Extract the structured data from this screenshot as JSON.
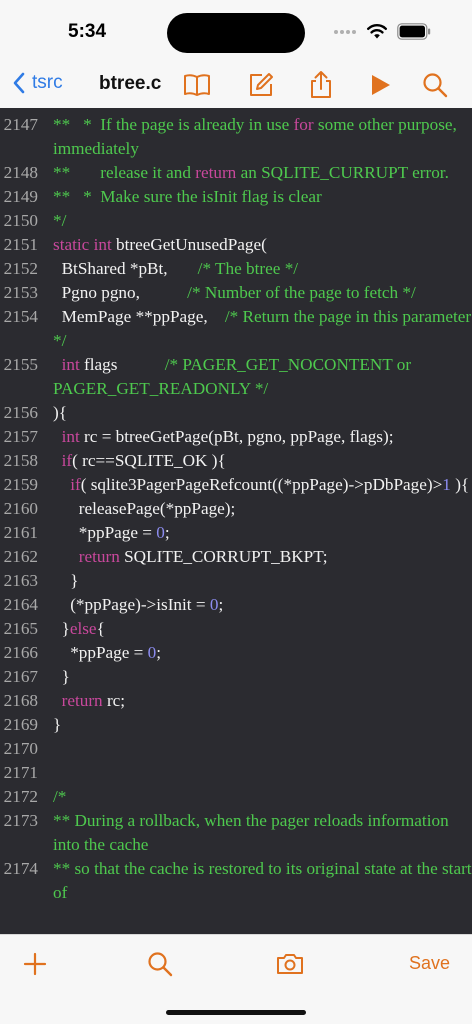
{
  "status_bar": {
    "time": "5:34"
  },
  "nav": {
    "back_label": "tsrc",
    "file_name": "btree.c"
  },
  "toolbar": {
    "save_label": "Save"
  },
  "colors": {
    "accent_orange": "#e0721f",
    "link_blue": "#2f7be5",
    "comment_green": "#4ec94e",
    "keyword_pink": "#c8489c",
    "number_purple": "#8d8df0",
    "editor_bg": "#2b2b30"
  },
  "icons": [
    "chevron-left-icon",
    "book-icon",
    "edit-icon",
    "share-icon",
    "play-icon",
    "search-icon",
    "plus-icon",
    "camera-icon"
  ],
  "code_lines": [
    {
      "num": "2147",
      "segments": [
        {
          "t": "**   *  If the page is already in use ",
          "s": "c"
        },
        {
          "t": "for",
          "s": "k"
        },
        {
          "t": " some other purpose, immediately",
          "s": "c"
        }
      ]
    },
    {
      "num": "2148",
      "segments": [
        {
          "t": "**       release it and ",
          "s": "c"
        },
        {
          "t": "return",
          "s": "k"
        },
        {
          "t": " an SQLITE_CURRUPT error.",
          "s": "c"
        }
      ]
    },
    {
      "num": "2149",
      "segments": [
        {
          "t": "**   *  Make sure the isInit flag is clear",
          "s": "c"
        }
      ]
    },
    {
      "num": "2150",
      "segments": [
        {
          "t": "*/",
          "s": "c"
        }
      ]
    },
    {
      "num": "2151",
      "segments": [
        {
          "t": "static",
          "s": "k"
        },
        {
          "t": " ",
          "s": ""
        },
        {
          "t": "int",
          "s": "k"
        },
        {
          "t": " btreeGetUnusedPage(",
          "s": ""
        }
      ]
    },
    {
      "num": "2152",
      "segments": [
        {
          "t": "  BtShared *pBt,       ",
          "s": ""
        },
        {
          "t": "/* The btree */",
          "s": "c"
        }
      ]
    },
    {
      "num": "2153",
      "segments": [
        {
          "t": "  Pgno pgno,           ",
          "s": ""
        },
        {
          "t": "/* Number of the page to fetch */",
          "s": "c"
        }
      ]
    },
    {
      "num": "2154",
      "segments": [
        {
          "t": "  MemPage **ppPage,    ",
          "s": ""
        },
        {
          "t": "/* Return the page in this parameter */",
          "s": "c"
        }
      ]
    },
    {
      "num": "2155",
      "segments": [
        {
          "t": "  ",
          "s": ""
        },
        {
          "t": "int",
          "s": "k"
        },
        {
          "t": " flags           ",
          "s": ""
        },
        {
          "t": "/* PAGER_GET_NOCONTENT or PAGER_GET_READONLY */",
          "s": "c"
        }
      ]
    },
    {
      "num": "2156",
      "segments": [
        {
          "t": "){",
          "s": ""
        }
      ]
    },
    {
      "num": "2157",
      "segments": [
        {
          "t": "  ",
          "s": ""
        },
        {
          "t": "int",
          "s": "k"
        },
        {
          "t": " rc = btreeGetPage(pBt, pgno, ppPage, flags);",
          "s": ""
        }
      ]
    },
    {
      "num": "2158",
      "segments": [
        {
          "t": "  ",
          "s": ""
        },
        {
          "t": "if",
          "s": "k"
        },
        {
          "t": "( rc==SQLITE_OK ){",
          "s": ""
        }
      ]
    },
    {
      "num": "2159",
      "segments": [
        {
          "t": "    ",
          "s": ""
        },
        {
          "t": "if",
          "s": "k"
        },
        {
          "t": "( sqlite3PagerPageRefcount((*ppPage)->pDbPage)>",
          "s": ""
        },
        {
          "t": "1",
          "s": "n"
        },
        {
          "t": " ){",
          "s": ""
        }
      ]
    },
    {
      "num": "2160",
      "segments": [
        {
          "t": "      releasePage(*ppPage);",
          "s": ""
        }
      ]
    },
    {
      "num": "2161",
      "segments": [
        {
          "t": "      *ppPage = ",
          "s": ""
        },
        {
          "t": "0",
          "s": "n"
        },
        {
          "t": ";",
          "s": ""
        }
      ]
    },
    {
      "num": "2162",
      "segments": [
        {
          "t": "      ",
          "s": ""
        },
        {
          "t": "return",
          "s": "k"
        },
        {
          "t": " SQLITE_CORRUPT_BKPT;",
          "s": ""
        }
      ]
    },
    {
      "num": "2163",
      "segments": [
        {
          "t": "    }",
          "s": ""
        }
      ]
    },
    {
      "num": "2164",
      "segments": [
        {
          "t": "    (*ppPage)->isInit = ",
          "s": ""
        },
        {
          "t": "0",
          "s": "n"
        },
        {
          "t": ";",
          "s": ""
        }
      ]
    },
    {
      "num": "2165",
      "segments": [
        {
          "t": "  }",
          "s": ""
        },
        {
          "t": "else",
          "s": "k"
        },
        {
          "t": "{",
          "s": ""
        }
      ]
    },
    {
      "num": "2166",
      "segments": [
        {
          "t": "    *ppPage = ",
          "s": ""
        },
        {
          "t": "0",
          "s": "n"
        },
        {
          "t": ";",
          "s": ""
        }
      ]
    },
    {
      "num": "2167",
      "segments": [
        {
          "t": "  }",
          "s": ""
        }
      ]
    },
    {
      "num": "2168",
      "segments": [
        {
          "t": "  ",
          "s": ""
        },
        {
          "t": "return",
          "s": "k"
        },
        {
          "t": " rc;",
          "s": ""
        }
      ]
    },
    {
      "num": "2169",
      "segments": [
        {
          "t": "}",
          "s": ""
        }
      ]
    },
    {
      "num": "2170",
      "segments": [
        {
          "t": "",
          "s": ""
        }
      ]
    },
    {
      "num": "2171",
      "segments": [
        {
          "t": "",
          "s": ""
        }
      ]
    },
    {
      "num": "2172",
      "segments": [
        {
          "t": "/*",
          "s": "c"
        }
      ]
    },
    {
      "num": "2173",
      "segments": [
        {
          "t": "** During a rollback, when the pager reloads information into the cache",
          "s": "c"
        }
      ]
    },
    {
      "num": "2174",
      "segments": [
        {
          "t": "** so that the cache is restored to its original state at the start of",
          "s": "c"
        }
      ]
    }
  ]
}
